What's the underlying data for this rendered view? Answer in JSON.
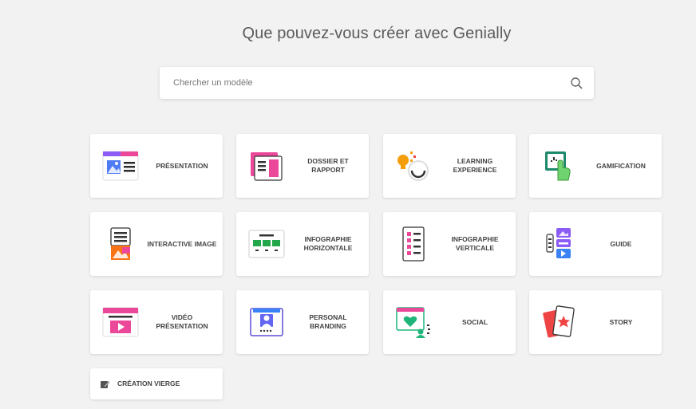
{
  "header": {
    "title": "Que pouvez-vous créer avec Genially"
  },
  "search": {
    "placeholder": "Chercher un modèle",
    "value": "",
    "icon": "search-icon"
  },
  "cards": [
    {
      "label": "Présentation",
      "icon": "presentation-icon"
    },
    {
      "label": "Dossier et rapport",
      "icon": "dossier-icon"
    },
    {
      "label": "Learning experience",
      "icon": "learning-icon"
    },
    {
      "label": "Gamification",
      "icon": "gamification-icon"
    },
    {
      "label": "Interactive image",
      "icon": "interactive-image-icon"
    },
    {
      "label": "Infographie horizontale",
      "icon": "infographie-horizontale-icon"
    },
    {
      "label": "Infographie verticale",
      "icon": "infographie-verticale-icon"
    },
    {
      "label": "Guide",
      "icon": "guide-icon"
    },
    {
      "label": "Vidéo présentation",
      "icon": "video-icon"
    },
    {
      "label": "Personal branding",
      "icon": "personal-branding-icon"
    },
    {
      "label": "Social",
      "icon": "social-icon"
    },
    {
      "label": "Story",
      "icon": "story-icon"
    },
    {
      "label": "Création vierge",
      "icon": "edit-icon"
    }
  ],
  "colors": {
    "background": "#f2f2f2",
    "card": "#ffffff",
    "text": "#444444"
  }
}
